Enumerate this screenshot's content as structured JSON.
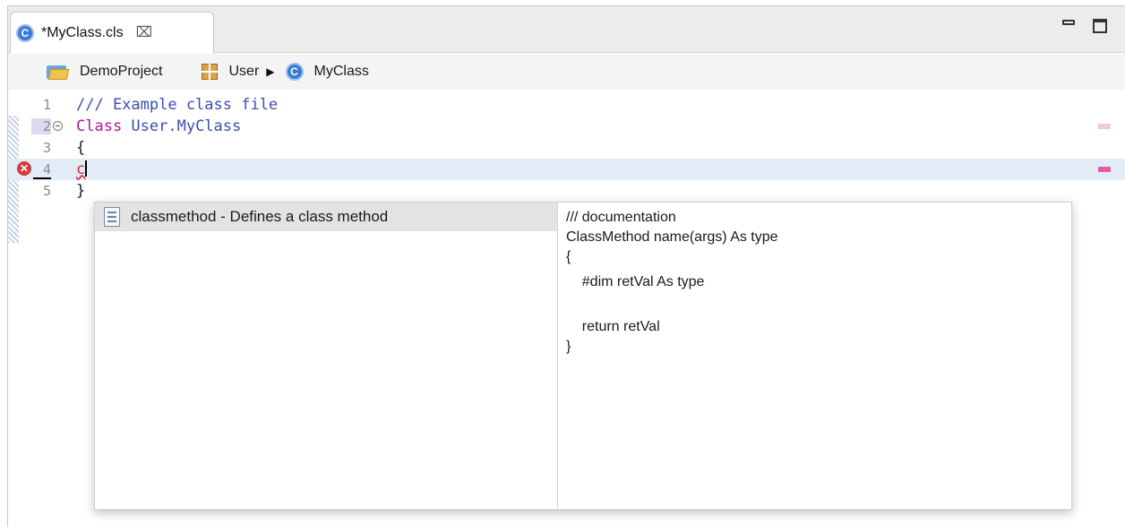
{
  "tab": {
    "icon_letter": "C",
    "title": "*MyClass.cls",
    "close_glyph": "⌧"
  },
  "breadcrumb": {
    "project": "DemoProject",
    "package": "User",
    "arrow": "▶",
    "class_icon_letter": "C",
    "class_name": "MyClass"
  },
  "code": {
    "lines": [
      {
        "num": "1",
        "text": "/// Example class file"
      },
      {
        "num": "2",
        "kw": "Class",
        "name": " User.MyClass"
      },
      {
        "num": "3",
        "text": "{"
      },
      {
        "num": "4",
        "text": "c"
      },
      {
        "num": "5",
        "text": "}"
      }
    ],
    "error_glyph": "✕"
  },
  "completion": {
    "proposal": "classmethod - Defines a class method",
    "doc_lines": [
      "/// documentation",
      "ClassMethod name(args) As type",
      "{",
      "    #dim retVal As type",
      "",
      "    return retVal",
      "}"
    ]
  },
  "colors": {
    "keyword": "#b0149c",
    "comment": "#3a4fb0",
    "error": "#d6293e",
    "current_line": "#e3ebf7",
    "selection": "#e3e3e3"
  }
}
